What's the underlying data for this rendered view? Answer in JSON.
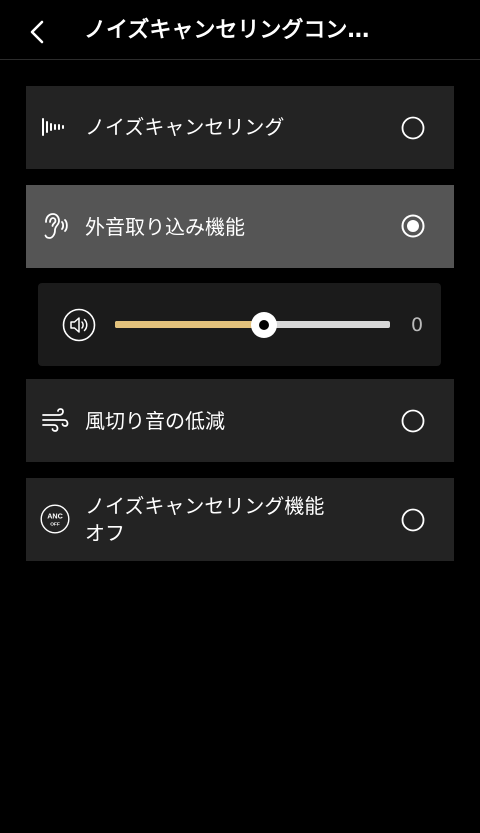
{
  "header": {
    "title": "ノイズキャンセリングコン…",
    "back_icon": "chevron-left-icon"
  },
  "options": [
    {
      "label": "ノイズキャンセリング",
      "icon": "sound-wave-icon",
      "selected": false
    },
    {
      "label": "外音取り込み機能",
      "icon": "ear-icon",
      "selected": true
    },
    {
      "label": "風切り音の低減",
      "icon": "wind-icon",
      "selected": false
    },
    {
      "label_line1": "ノイズキャンセリング機能",
      "label_line2": "オフ",
      "icon": "anc-off-icon",
      "icon_text_top": "ANC",
      "icon_text_bottom": "OFF",
      "selected": false
    }
  ],
  "ambient_slider": {
    "icon": "volume-icon",
    "value": "0",
    "position_fraction": 0.54
  },
  "colors": {
    "background": "#000000",
    "option_bg": "#232323",
    "option_selected_bg": "#555555",
    "slider_accent": "#e3c27c"
  }
}
